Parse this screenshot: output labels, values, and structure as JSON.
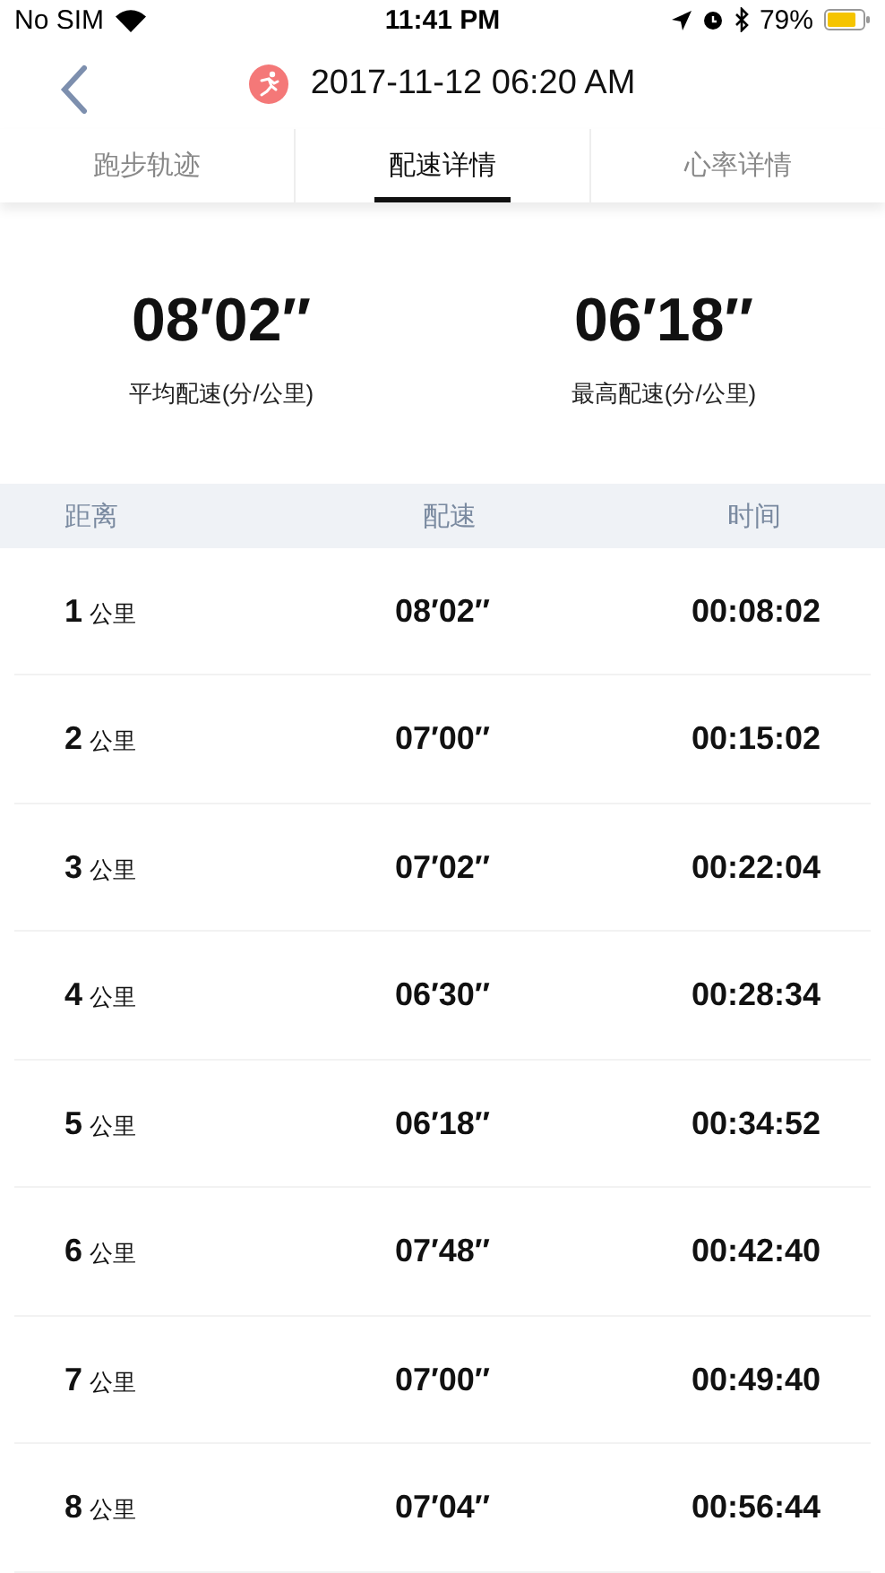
{
  "status_bar": {
    "carrier": "No SIM",
    "time": "11:41 PM",
    "battery": "79%"
  },
  "header": {
    "title": "2017-11-12 06:20 AM"
  },
  "tabs": [
    {
      "label": "跑步轨迹",
      "selected": false
    },
    {
      "label": "配速详情",
      "selected": true
    },
    {
      "label": "心率详情",
      "selected": false
    }
  ],
  "summary": [
    {
      "value": "08′02″",
      "label": "平均配速(分/公里)"
    },
    {
      "value": "06′18″",
      "label": "最高配速(分/公里)"
    }
  ],
  "table": {
    "columns": [
      "距离",
      "配速",
      "时间"
    ],
    "rows": [
      {
        "distance": "1",
        "unit": "公里",
        "pace": "08′02″",
        "time": "00:08:02"
      },
      {
        "distance": "2",
        "unit": "公里",
        "pace": "07′00″",
        "time": "00:15:02"
      },
      {
        "distance": "3",
        "unit": "公里",
        "pace": "07′02″",
        "time": "00:22:04"
      },
      {
        "distance": "4",
        "unit": "公里",
        "pace": "06′30″",
        "time": "00:28:34"
      },
      {
        "distance": "5",
        "unit": "公里",
        "pace": "06′18″",
        "time": "00:34:52"
      },
      {
        "distance": "6",
        "unit": "公里",
        "pace": "07′48″",
        "time": "00:42:40"
      },
      {
        "distance": "7",
        "unit": "公里",
        "pace": "07′00″",
        "time": "00:49:40"
      },
      {
        "distance": "8",
        "unit": "公里",
        "pace": "07′04″",
        "time": "00:56:44"
      }
    ]
  }
}
